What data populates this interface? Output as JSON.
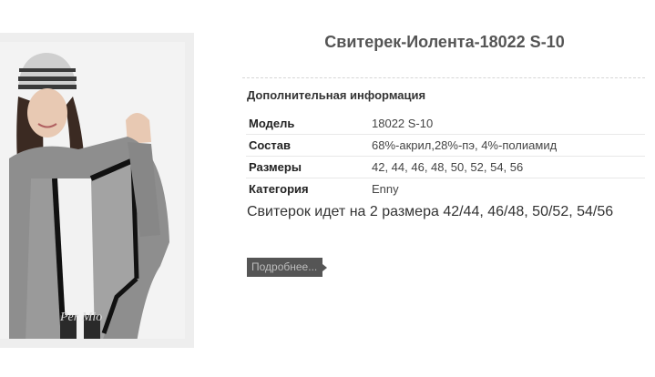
{
  "product": {
    "title": "Свитерек-Иолента-18022 S-10",
    "image_alt": "Свитерек-Иолента",
    "watermark_brand": "Per Mio",
    "section_heading": "Дополнительная информация",
    "attributes": [
      {
        "label": "Модель",
        "value": "18022 S-10"
      },
      {
        "label": "Состав",
        "value": "68%-акрил,28%-пэ, 4%-полиамид"
      },
      {
        "label": "Размеры",
        "value": "42, 44, 46, 48, 50, 52, 54, 56"
      },
      {
        "label": "Категория",
        "value": "Enny"
      }
    ],
    "description": "Свитерок идет на 2 размера 42/44, 46/48, 50/52, 54/56",
    "more_button_label": "Подробнее..."
  }
}
